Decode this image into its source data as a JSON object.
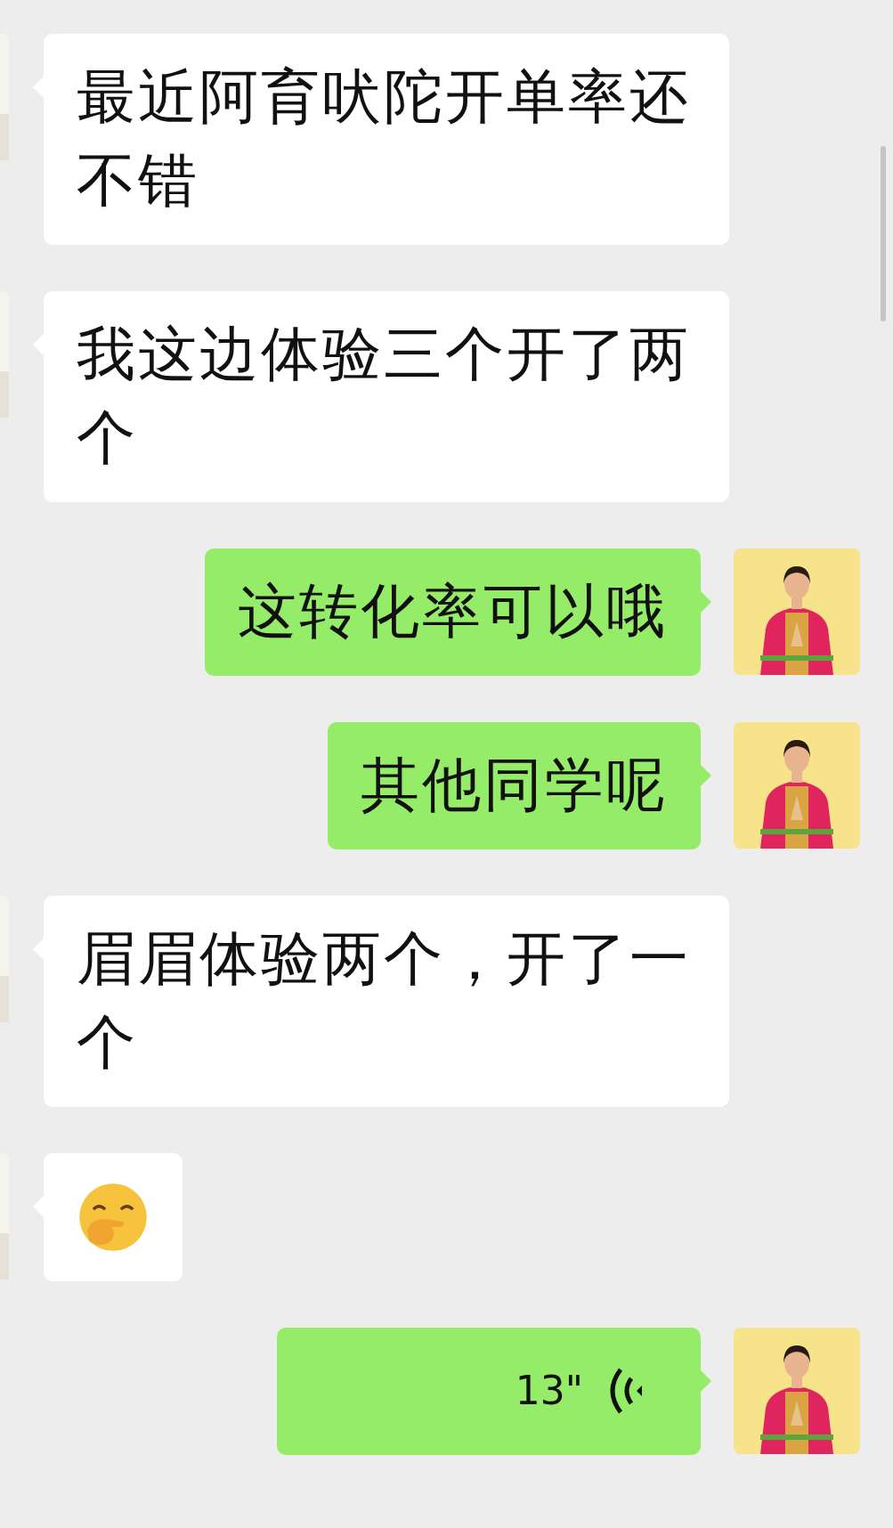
{
  "messages": [
    {
      "outgoing": false,
      "kind": "text",
      "text": "最近阿育吠陀开单率还不错"
    },
    {
      "outgoing": false,
      "kind": "text",
      "text": "我这边体验三个开了两个"
    },
    {
      "outgoing": true,
      "kind": "text",
      "text": "这转化率可以哦"
    },
    {
      "outgoing": true,
      "kind": "text",
      "text": "其他同学呢"
    },
    {
      "outgoing": false,
      "kind": "text",
      "text": "眉眉体验两个，开了一个"
    },
    {
      "outgoing": false,
      "kind": "emoji"
    },
    {
      "outgoing": true,
      "kind": "voice",
      "duration": "13\""
    }
  ]
}
